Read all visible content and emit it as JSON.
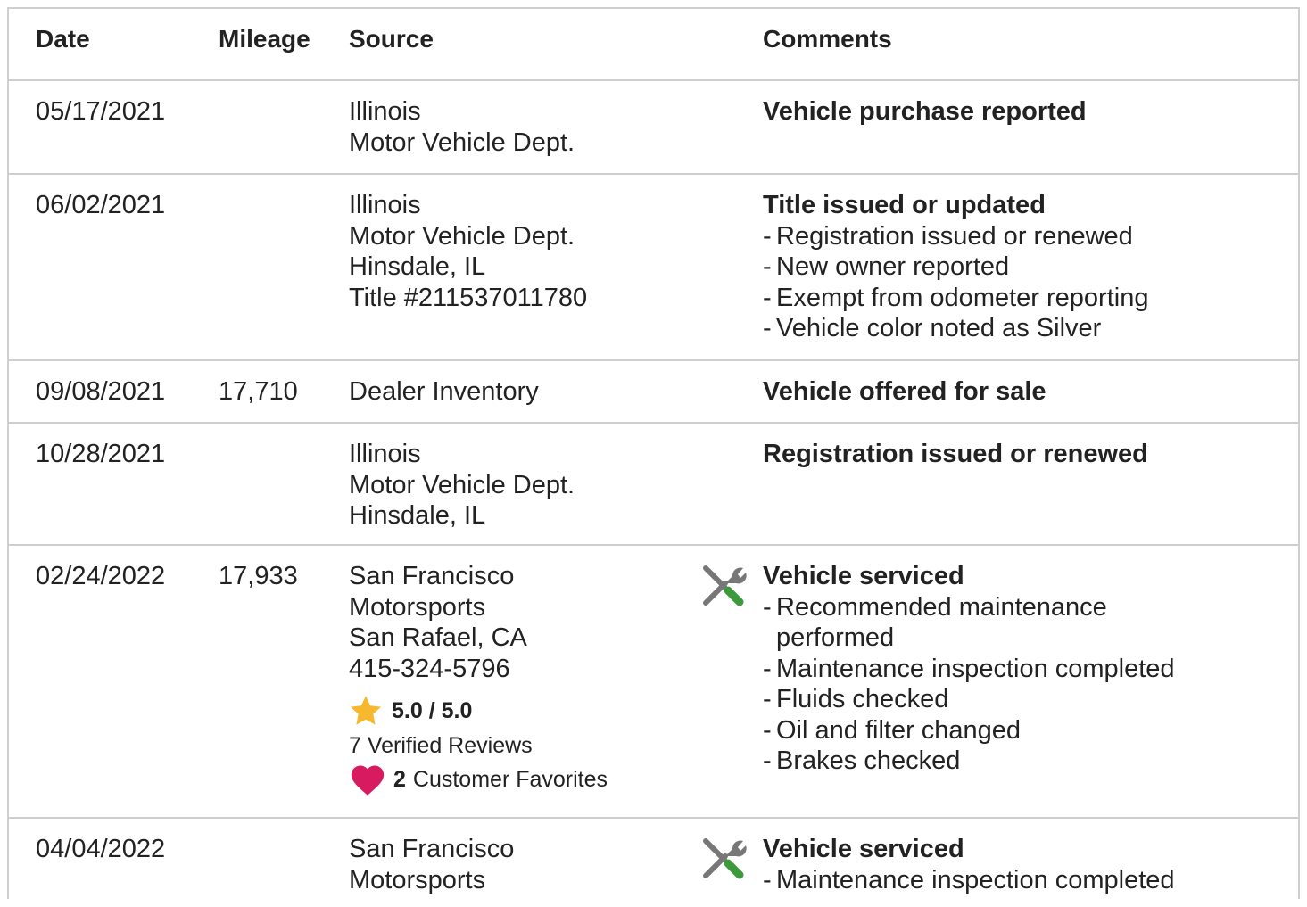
{
  "headers": {
    "date": "Date",
    "mileage": "Mileage",
    "source": "Source",
    "comments": "Comments"
  },
  "rows": [
    {
      "date": "05/17/2021",
      "mileage": "",
      "source": [
        "Illinois",
        "Motor Vehicle Dept."
      ],
      "title": "Vehicle purchase reported",
      "items": []
    },
    {
      "date": "06/02/2021",
      "mileage": "",
      "source": [
        "Illinois",
        "Motor Vehicle Dept.",
        "Hinsdale, IL",
        "Title #211537011780"
      ],
      "title": "Title issued or updated",
      "items": [
        "Registration issued or renewed",
        "New owner reported",
        "Exempt from odometer reporting",
        "Vehicle color noted as Silver"
      ]
    },
    {
      "date": "09/08/2021",
      "mileage": "17,710",
      "source": [
        "Dealer Inventory"
      ],
      "title": "Vehicle offered for sale",
      "items": []
    },
    {
      "date": "10/28/2021",
      "mileage": "",
      "source": [
        "Illinois",
        "Motor Vehicle Dept.",
        "Hinsdale, IL"
      ],
      "title": "Registration issued or renewed",
      "items": []
    },
    {
      "date": "02/24/2022",
      "mileage": "17,933",
      "source": [
        "San Francisco",
        "Motorsports",
        "San Rafael, CA",
        "415-324-5796"
      ],
      "rating": "5.0 / 5.0",
      "rating_value": 5.0,
      "reviews": "7 Verified Reviews",
      "favorites_count": "2",
      "favorites_label": "Customer Favorites",
      "icon": "service-tools-icon",
      "title": "Vehicle serviced",
      "items": [
        "Recommended maintenance performed",
        "Maintenance inspection completed",
        "Fluids checked",
        "Oil and filter changed",
        "Brakes checked"
      ]
    },
    {
      "date": "04/04/2022",
      "mileage": "",
      "source": [
        "San Francisco",
        "Motorsports"
      ],
      "icon": "service-tools-icon",
      "title": "Vehicle serviced",
      "items": [
        "Maintenance inspection completed"
      ]
    }
  ],
  "colors": {
    "star": "#f5b82e",
    "heart": "#d81b60",
    "wrench_handle": "#3c9a3c",
    "tool_gray": "#777777",
    "border": "#cfcfcf"
  }
}
